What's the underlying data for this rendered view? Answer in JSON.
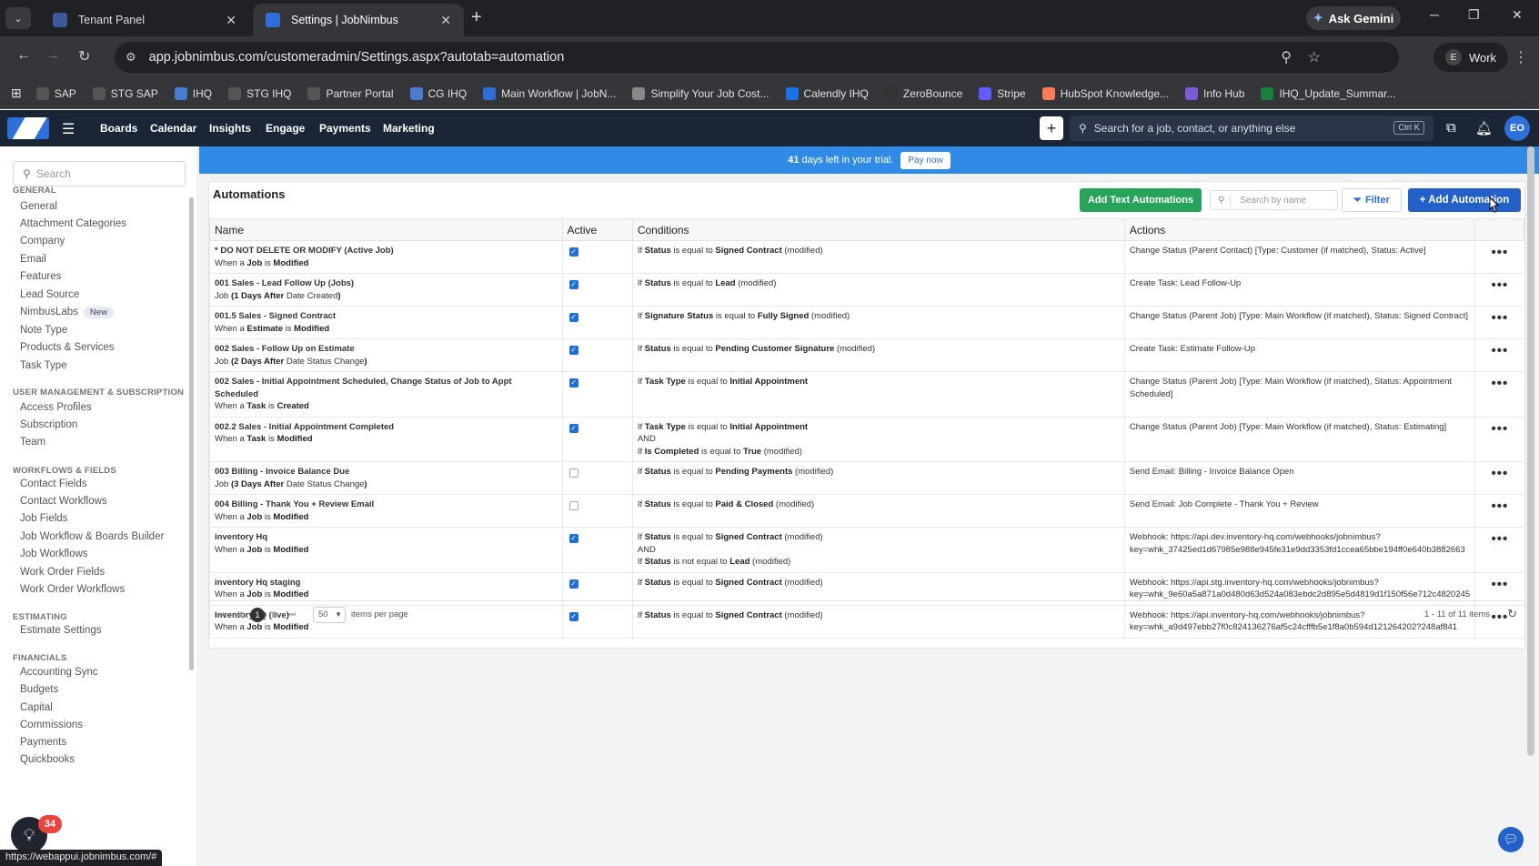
{
  "browser": {
    "tabs": [
      {
        "title": "Tenant Panel"
      },
      {
        "title": "Settings | JobNimbus"
      }
    ],
    "gemini_label": "Ask Gemini",
    "url": "app.jobnimbus.com/customeradmin/Settings.aspx?autotab=automation",
    "profile_initial": "E",
    "profile_label": "Work",
    "bookmarks": [
      {
        "label": "SAP",
        "color": "#555"
      },
      {
        "label": "STG SAP",
        "color": "#555"
      },
      {
        "label": "IHQ",
        "color": "#4a7bd0"
      },
      {
        "label": "STG IHQ",
        "color": "#555"
      },
      {
        "label": "Partner Portal",
        "color": "#555"
      },
      {
        "label": "CG IHQ",
        "color": "#4a7bd0"
      },
      {
        "label": "Main Workflow | JobN...",
        "color": "#2f6fd9"
      },
      {
        "label": "Simplify Your Job Cost...",
        "color": "#888"
      },
      {
        "label": "Calendly IHQ",
        "color": "#1a73e8"
      },
      {
        "label": "ZeroBounce",
        "color": "#333"
      },
      {
        "label": "Stripe",
        "color": "#635bff"
      },
      {
        "label": "HubSpot Knowledge...",
        "color": "#ff7a59"
      },
      {
        "label": "Info Hub",
        "color": "#7b5bd6"
      },
      {
        "label": "IHQ_Update_Summar...",
        "color": "#188038"
      }
    ],
    "status_url": "https://webappui.jobnimbus.com/#"
  },
  "appnav": {
    "links": [
      "Boards",
      "Calendar",
      "Insights",
      "Engage",
      "Payments",
      "Marketing"
    ],
    "search_placeholder": "Search for a job, contact, or anything else",
    "shortcut": "Ctrl K",
    "avatar": "EO"
  },
  "sidebar": {
    "search_placeholder": "Search",
    "sections": [
      {
        "title": "GENERAL",
        "items": [
          "General",
          "Attachment Categories",
          "Company",
          "Email",
          "Features",
          "Lead Source",
          "NimbusLabs",
          "Note Type",
          "Products & Services",
          "Task Type"
        ]
      },
      {
        "title": "USER MANAGEMENT & SUBSCRIPTION",
        "items": [
          "Access Profiles",
          "Subscription",
          "Team"
        ]
      },
      {
        "title": "WORKFLOWS & FIELDS",
        "items": [
          "Contact Fields",
          "Contact Workflows",
          "Job Fields",
          "Job Workflow & Boards Builder",
          "Job Workflows",
          "Work Order Fields",
          "Work Order Workflows"
        ]
      },
      {
        "title": "ESTIMATING",
        "items": [
          "Estimate Settings"
        ]
      },
      {
        "title": "FINANCIALS",
        "items": [
          "Accounting Sync",
          "Budgets",
          "Capital",
          "Commissions",
          "Payments",
          "Quickbooks"
        ]
      }
    ],
    "new_badge": "New",
    "notif_count": "34"
  },
  "trial": {
    "days": "41",
    "text": "days left in your trial.",
    "pay_label": "Pay now"
  },
  "automations": {
    "title": "Automations",
    "add_text_label": "Add Text Automations",
    "search_placeholder": "Search by name",
    "filter_label": "Filter",
    "add_label": "+ Add Automation",
    "columns": [
      "Name",
      "Active",
      "Conditions",
      "Actions"
    ],
    "rows": [
      {
        "name": "* DO NOT DELETE OR MODIFY (Active Job)",
        "trigger": [
          "When a ",
          "Job",
          " is ",
          "Modified"
        ],
        "active": true,
        "conditions": [
          [
            [
              "If ",
              ""
            ],
            [
              "Status",
              "b"
            ],
            [
              " is equal to ",
              ""
            ],
            [
              "Signed Contract",
              "b"
            ],
            [
              " (modified)",
              ""
            ]
          ]
        ],
        "actions": [
          "Change Status (Parent Contact) [Type: Customer (if matched), Status: Active]"
        ]
      },
      {
        "name": "001 Sales - Lead Follow Up (Jobs)",
        "trigger": [
          "Job",
          " (1 Days After ",
          "Date Created",
          ")"
        ],
        "active": true,
        "conditions": [
          [
            [
              "If ",
              ""
            ],
            [
              "Status",
              "b"
            ],
            [
              " is equal to ",
              ""
            ],
            [
              "Lead",
              "b"
            ],
            [
              " (modified)",
              ""
            ]
          ]
        ],
        "actions": [
          "Create Task: Lead Follow-Up"
        ]
      },
      {
        "name": "001.5 Sales - Signed Contract",
        "trigger": [
          "When a ",
          "Estimate",
          " is ",
          "Modified"
        ],
        "active": true,
        "conditions": [
          [
            [
              "If ",
              ""
            ],
            [
              "Signature Status",
              "b"
            ],
            [
              " is equal to ",
              ""
            ],
            [
              "Fully Signed",
              "b"
            ],
            [
              " (modified)",
              ""
            ]
          ]
        ],
        "actions": [
          "Change Status (Parent Job) [Type: Main Workflow (if matched), Status: Signed Contract]"
        ]
      },
      {
        "name": "002 Sales - Follow Up on Estimate",
        "trigger": [
          "Job",
          " (2 Days After ",
          "Date Status Change",
          ")"
        ],
        "active": true,
        "conditions": [
          [
            [
              "If ",
              ""
            ],
            [
              "Status",
              "b"
            ],
            [
              " is equal to ",
              ""
            ],
            [
              "Pending Customer Signature",
              "b"
            ],
            [
              " (modified)",
              ""
            ]
          ]
        ],
        "actions": [
          "Create Task: Estimate Follow-Up"
        ]
      },
      {
        "name": "002 Sales - Initial Appointment Scheduled, Change Status of Job to Appt Scheduled",
        "trigger": [
          "When a ",
          "Task",
          " is ",
          "Created"
        ],
        "active": true,
        "conditions": [
          [
            [
              "If ",
              ""
            ],
            [
              "Task Type",
              "b"
            ],
            [
              " is equal to ",
              ""
            ],
            [
              "Initial Appointment",
              "b"
            ],
            [
              "",
              ""
            ]
          ]
        ],
        "actions": [
          "Change Status (Parent Job) [Type: Main Workflow (if matched), Status: Appointment",
          "Scheduled]"
        ]
      },
      {
        "name": "002.2 Sales - Initial Appointment Completed",
        "trigger": [
          "When a ",
          "Task",
          " is ",
          "Modified"
        ],
        "active": true,
        "conditions": [
          [
            [
              "If ",
              ""
            ],
            [
              "Task Type",
              "b"
            ],
            [
              " is equal to ",
              ""
            ],
            [
              "Initial Appointment",
              "b"
            ],
            [
              "",
              ""
            ]
          ],
          [
            [
              "AND",
              ""
            ]
          ],
          [
            [
              "If ",
              ""
            ],
            [
              "Is Completed",
              "b"
            ],
            [
              " is equal to ",
              ""
            ],
            [
              "True",
              "b"
            ],
            [
              " (modified)",
              ""
            ]
          ]
        ],
        "actions": [
          "Change Status (Parent Job) [Type: Main Workflow (if matched), Status: Estimating]"
        ]
      },
      {
        "name": "003 Billing - Invoice Balance Due",
        "trigger": [
          "Job",
          " (3 Days After ",
          "Date Status Change",
          ")"
        ],
        "active": false,
        "conditions": [
          [
            [
              "If ",
              ""
            ],
            [
              "Status",
              "b"
            ],
            [
              " is equal to ",
              ""
            ],
            [
              "Pending Payments",
              "b"
            ],
            [
              " (modified)",
              ""
            ]
          ]
        ],
        "actions": [
          "Send Email: Billing - Invoice Balance Open"
        ]
      },
      {
        "name": "004 Billing - Thank You + Review Email",
        "trigger": [
          "When a ",
          "Job",
          " is ",
          "Modified"
        ],
        "active": false,
        "conditions": [
          [
            [
              "If ",
              ""
            ],
            [
              "Status",
              "b"
            ],
            [
              " is equal to ",
              ""
            ],
            [
              "Paid & Closed",
              "b"
            ],
            [
              " (modified)",
              ""
            ]
          ]
        ],
        "actions": [
          "Send Email: Job Complete - Thank You + Review"
        ]
      },
      {
        "name": "inventory Hq",
        "trigger": [
          "When a ",
          "Job",
          " is ",
          "Modified"
        ],
        "active": true,
        "conditions": [
          [
            [
              "If ",
              ""
            ],
            [
              "Status",
              "b"
            ],
            [
              " is equal to ",
              ""
            ],
            [
              "Signed Contract",
              "b"
            ],
            [
              " (modified)",
              ""
            ]
          ],
          [
            [
              "AND",
              ""
            ]
          ],
          [
            [
              "If ",
              ""
            ],
            [
              "Status",
              "b"
            ],
            [
              " is not equal to ",
              ""
            ],
            [
              "Lead",
              "b"
            ],
            [
              " (modified)",
              ""
            ]
          ]
        ],
        "actions": [
          "Webhook: https://api.dev.inventory-hq.com/webhooks/jobnimbus?",
          "key=whk_37425ed1d67985e988e945fe31e9dd3353fd1ccea65bbe194ff0e640b3882663"
        ]
      },
      {
        "name": "inventory Hq staging",
        "trigger": [
          "When a ",
          "Job",
          " is ",
          "Modified"
        ],
        "active": true,
        "conditions": [
          [
            [
              "If ",
              ""
            ],
            [
              "Status",
              "b"
            ],
            [
              " is equal to ",
              ""
            ],
            [
              "Signed Contract",
              "b"
            ],
            [
              " (modified)",
              ""
            ]
          ]
        ],
        "actions": [
          "Webhook: https://api.stg.inventory-hq.com/webhooks/jobnimbus?",
          "key=whk_9e60a5a871a0d480d63d524a083ebdc2d895e5d4819d1f150f56e712c4820245"
        ]
      },
      {
        "name": "InventoryHQ (live)",
        "trigger": [
          "When a ",
          "Job",
          " is ",
          "Modified"
        ],
        "active": true,
        "conditions": [
          [
            [
              "If ",
              ""
            ],
            [
              "Status",
              "b"
            ],
            [
              " is equal to ",
              ""
            ],
            [
              "Signed Contract",
              "b"
            ],
            [
              " (modified)",
              ""
            ]
          ]
        ],
        "actions": [
          "Webhook: https://api.inventory-hq.com/webhooks/jobnimbus?",
          "key=whk_a9d497ebb27f0c824136276af5c24cfffb5e1f8a0b594d121264202?248af841"
        ]
      }
    ],
    "pager": {
      "current": "1",
      "per_page": "50",
      "per_page_label": "items per page",
      "count": "1 - 11 of 11 items"
    }
  },
  "colors": {
    "accent": "#2460c9",
    "green": "#27a35a",
    "trial": "#2f8be6",
    "nav": "#1c2536"
  }
}
